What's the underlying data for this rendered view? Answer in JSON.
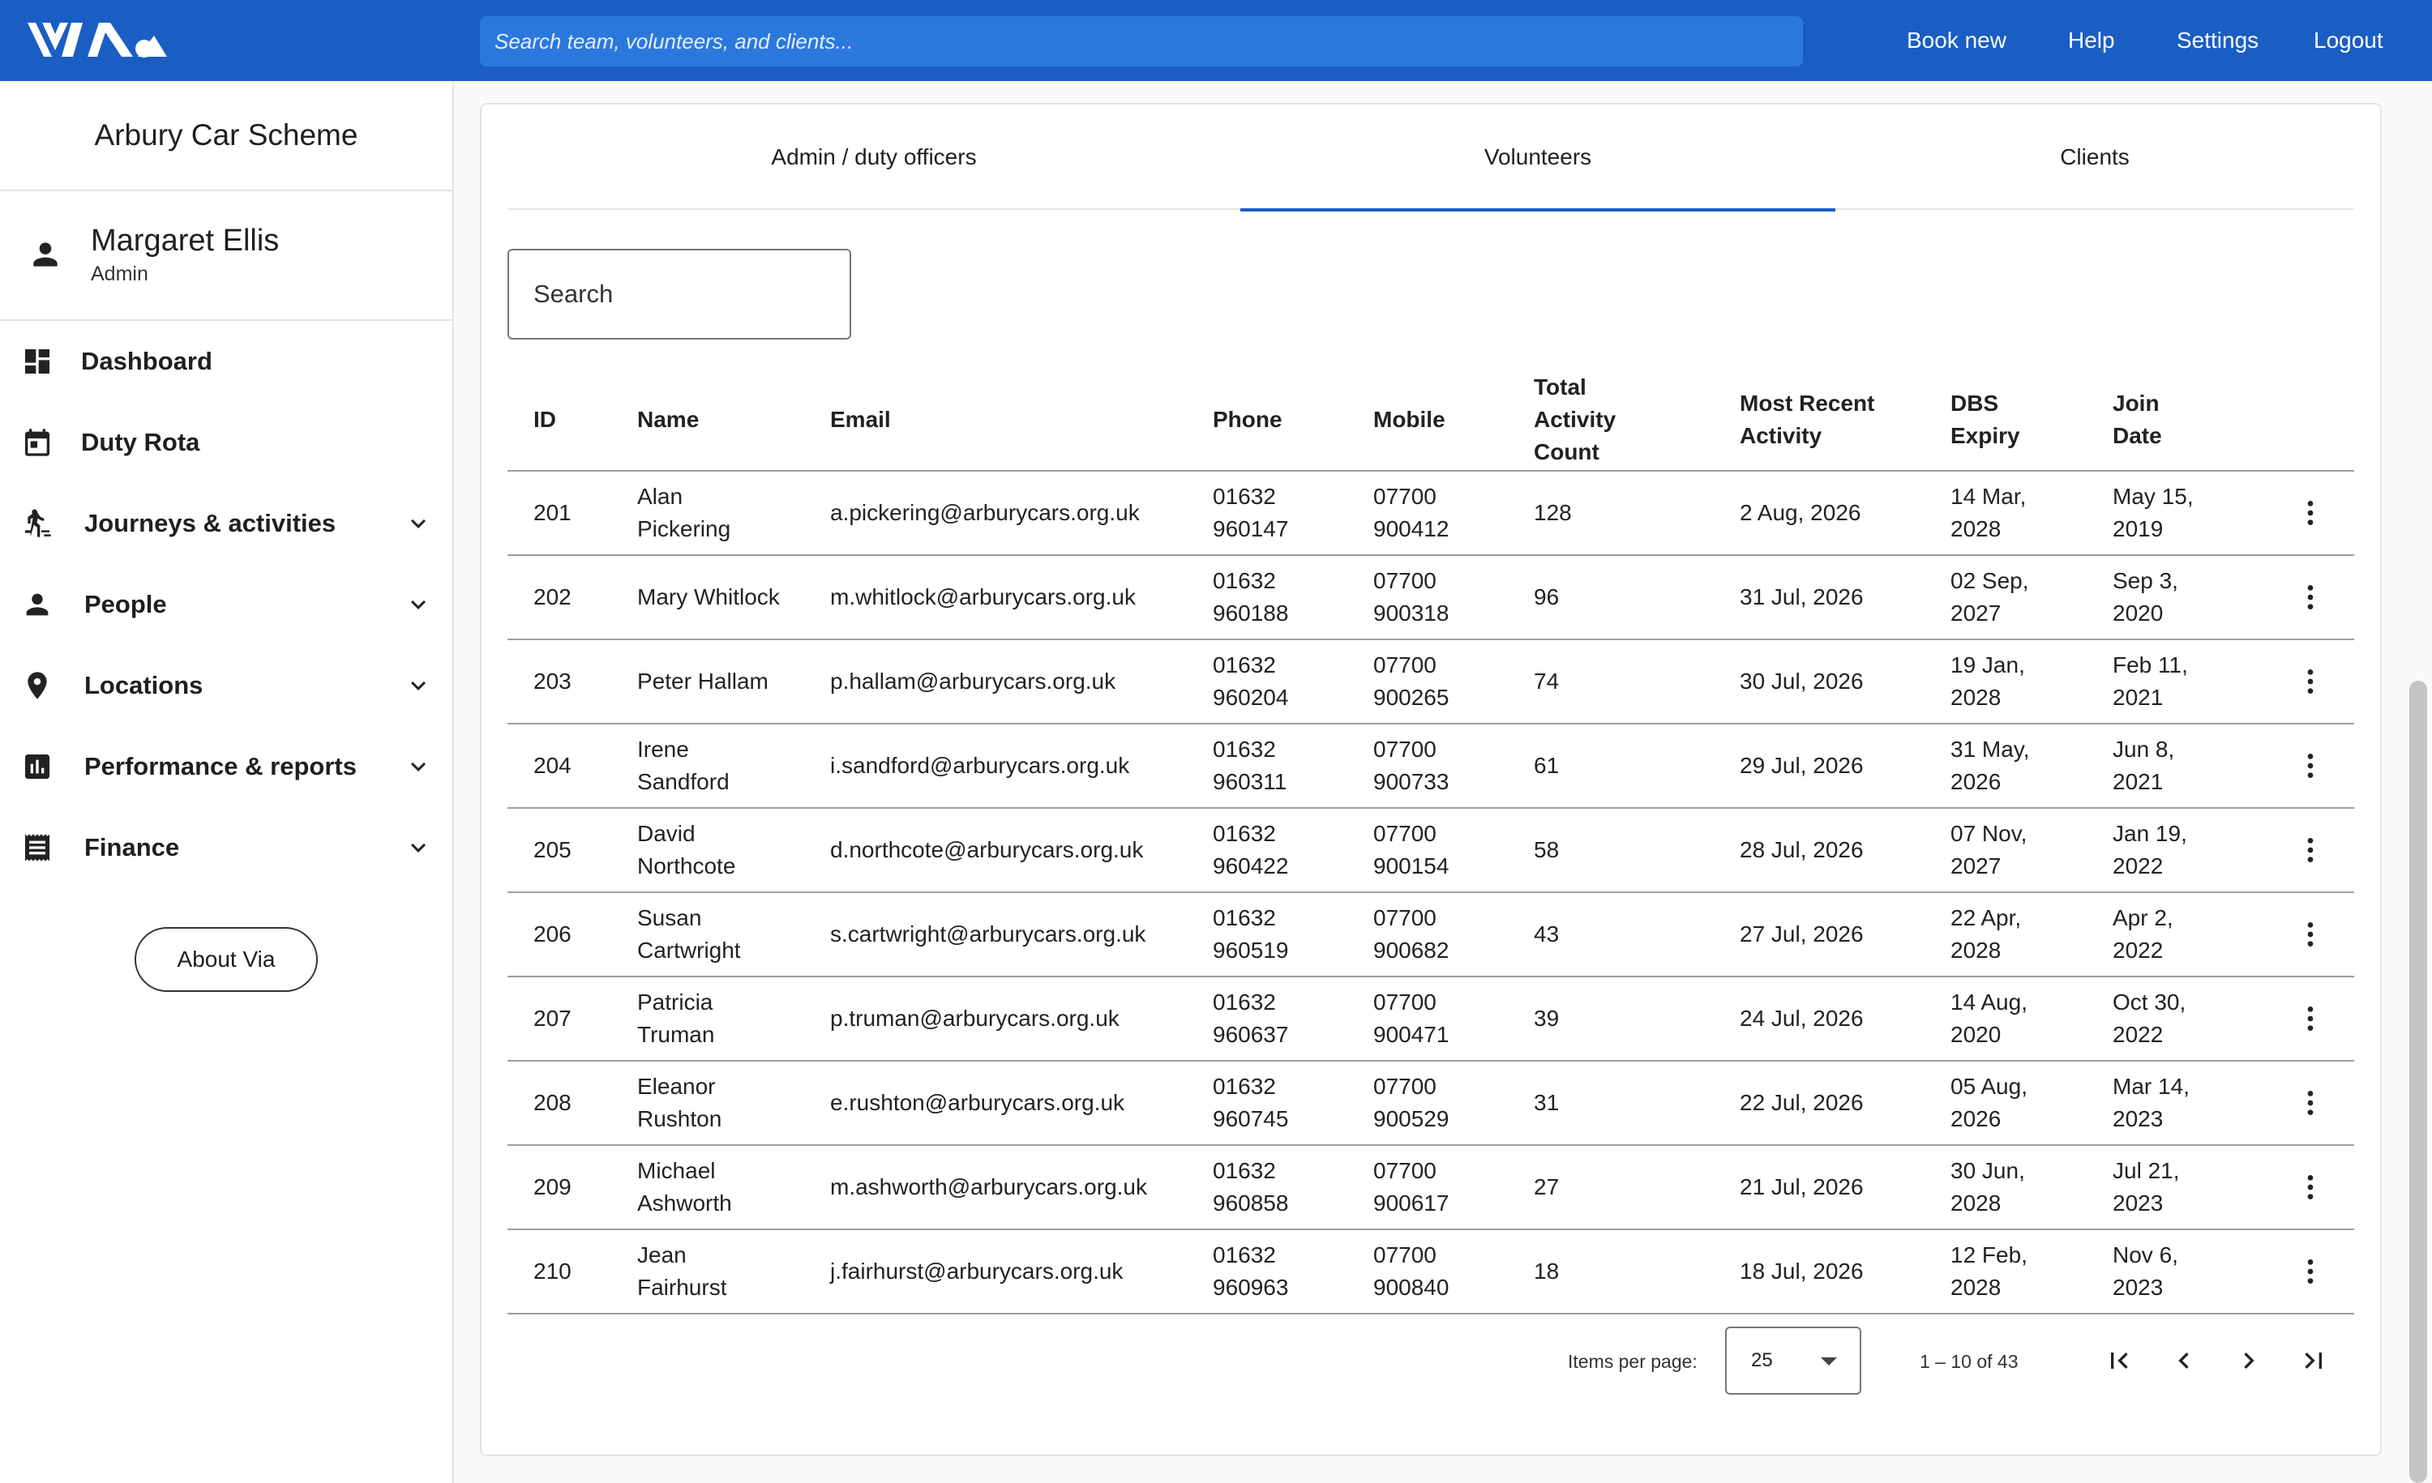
{
  "header": {
    "logo_text": "via",
    "search_placeholder": "Search team, volunteers, and clients...",
    "nav": [
      "Book new",
      "Help",
      "Settings",
      "Logout"
    ],
    "brand_color": "#1a5ec4"
  },
  "sidebar": {
    "org_name": "Arbury Car Scheme",
    "user": {
      "name": "Margaret Ellis",
      "role": "Admin"
    },
    "items": [
      {
        "label": "Dashboard",
        "icon": "dashboard-icon",
        "expandable": false
      },
      {
        "label": "Duty Rota",
        "icon": "calendar-icon",
        "expandable": false
      },
      {
        "label": "Journeys & activities",
        "icon": "walker-icon",
        "expandable": true
      },
      {
        "label": "People",
        "icon": "person-icon",
        "expandable": true
      },
      {
        "label": "Locations",
        "icon": "location-pin-icon",
        "expandable": true
      },
      {
        "label": "Performance & reports",
        "icon": "bar-chart-icon",
        "expandable": true
      },
      {
        "label": "Finance",
        "icon": "receipt-icon",
        "expandable": true
      }
    ],
    "about_label": "About Via"
  },
  "tabs": {
    "items": [
      "Admin / duty officers",
      "Volunteers",
      "Clients"
    ],
    "active": "Volunteers"
  },
  "search": {
    "placeholder": "Search"
  },
  "table": {
    "columns": [
      "ID",
      "Name",
      "Email",
      "Phone",
      "Mobile",
      "Total Activity Count",
      "Most Recent Activity",
      "DBS Expiry",
      "Join Date"
    ],
    "rows": [
      {
        "id": "201",
        "name": "Alan Pickering",
        "email": "a.pickering@arburycars.org.uk",
        "phone": "01632 960147",
        "mobile": "07700 900412",
        "count": "128",
        "recent": "2 Aug, 2026",
        "dbs": "14 Mar, 2028",
        "join": "May 15, 2019"
      },
      {
        "id": "202",
        "name": "Mary Whitlock",
        "email": "m.whitlock@arburycars.org.uk",
        "phone": "01632 960188",
        "mobile": "07700 900318",
        "count": "96",
        "recent": "31 Jul, 2026",
        "dbs": "02 Sep, 2027",
        "join": "Sep 3, 2020"
      },
      {
        "id": "203",
        "name": "Peter Hallam",
        "email": "p.hallam@arburycars.org.uk",
        "phone": "01632 960204",
        "mobile": "07700 900265",
        "count": "74",
        "recent": "30 Jul, 2026",
        "dbs": "19 Jan, 2028",
        "join": "Feb 11, 2021"
      },
      {
        "id": "204",
        "name": "Irene Sandford",
        "email": "i.sandford@arburycars.org.uk",
        "phone": "01632 960311",
        "mobile": "07700 900733",
        "count": "61",
        "recent": "29 Jul, 2026",
        "dbs": "31 May, 2026",
        "join": "Jun 8, 2021"
      },
      {
        "id": "205",
        "name": "David Northcote",
        "email": "d.northcote@arburycars.org.uk",
        "phone": "01632 960422",
        "mobile": "07700 900154",
        "count": "58",
        "recent": "28 Jul, 2026",
        "dbs": "07 Nov, 2027",
        "join": "Jan 19, 2022"
      },
      {
        "id": "206",
        "name": "Susan Cartwright",
        "email": "s.cartwright@arburycars.org.uk",
        "phone": "01632 960519",
        "mobile": "07700 900682",
        "count": "43",
        "recent": "27 Jul, 2026",
        "dbs": "22 Apr, 2028",
        "join": "Apr 2, 2022"
      },
      {
        "id": "207",
        "name": "Patricia Truman",
        "email": "p.truman@arburycars.org.uk",
        "phone": "01632 960637",
        "mobile": "07700 900471",
        "count": "39",
        "recent": "24 Jul, 2026",
        "dbs": "14 Aug, 2020",
        "join": "Oct 30, 2022"
      },
      {
        "id": "208",
        "name": "Eleanor Rushton",
        "email": "e.rushton@arburycars.org.uk",
        "phone": "01632 960745",
        "mobile": "07700 900529",
        "count": "31",
        "recent": "22 Jul, 2026",
        "dbs": "05 Aug, 2026",
        "join": "Mar 14, 2023"
      },
      {
        "id": "209",
        "name": "Michael Ashworth",
        "email": "m.ashworth@arburycars.org.uk",
        "phone": "01632 960858",
        "mobile": "07700 900617",
        "count": "27",
        "recent": "21 Jul, 2026",
        "dbs": "30 Jun, 2028",
        "join": "Jul 21, 2023"
      },
      {
        "id": "210",
        "name": "Jean Fairhurst",
        "email": "j.fairhurst@arburycars.org.uk",
        "phone": "01632 960963",
        "mobile": "07700 900840",
        "count": "18",
        "recent": "18 Jul, 2026",
        "dbs": "12 Feb, 2028",
        "join": "Nov 6, 2023"
      }
    ]
  },
  "pagination": {
    "items_per_page_label": "Items per page:",
    "items_per_page": "25",
    "range": "1 – 10 of 43"
  }
}
